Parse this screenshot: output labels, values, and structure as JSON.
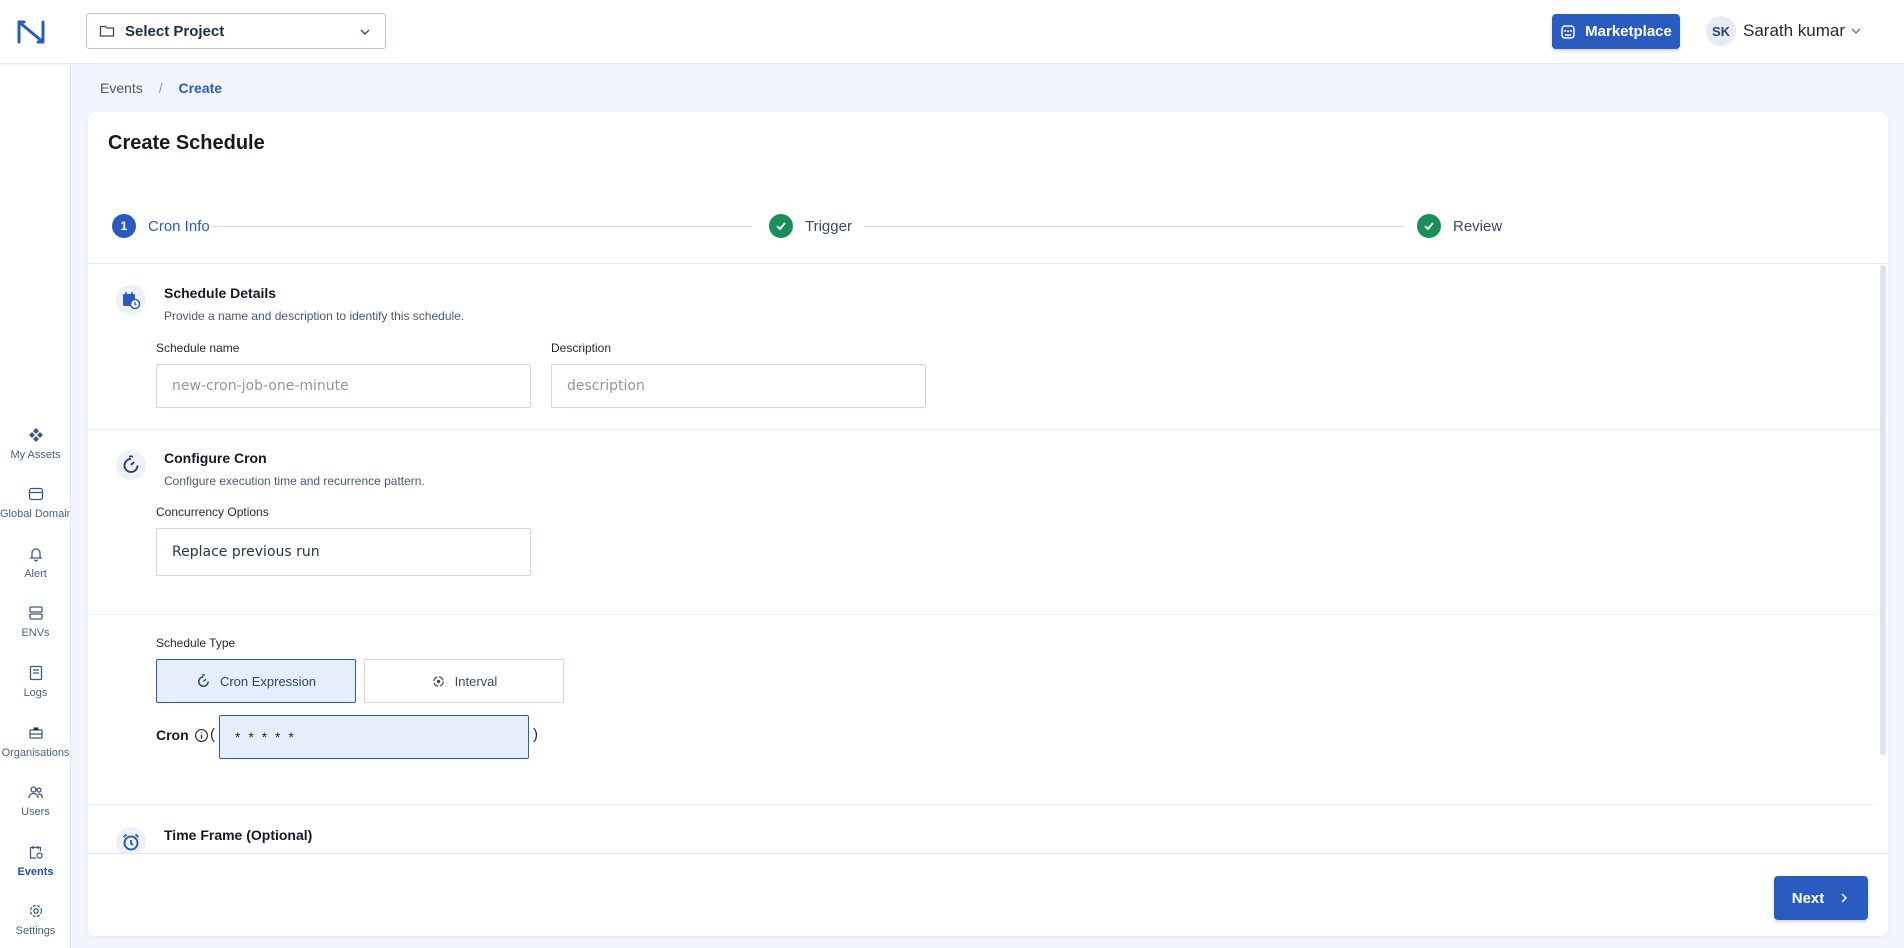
{
  "header": {
    "project_selector": "Select Project",
    "marketplace": "Marketplace",
    "user_initials": "SK",
    "user_name": "Sarath kumar"
  },
  "sidebar": {
    "items": [
      {
        "label": "My Assets",
        "icon": "diamond-icon"
      },
      {
        "label": "Global Domain",
        "icon": "store-icon"
      },
      {
        "label": "Alert",
        "icon": "bell-icon"
      },
      {
        "label": "ENVs",
        "icon": "server-icon"
      },
      {
        "label": "Logs",
        "icon": "book-icon"
      },
      {
        "label": "Organisations",
        "icon": "briefcase-icon"
      },
      {
        "label": "Users",
        "icon": "users-icon"
      },
      {
        "label": "Events",
        "icon": "calendar-gear-icon",
        "active": true
      },
      {
        "label": "Settings",
        "icon": "gear-icon"
      }
    ]
  },
  "breadcrumb": {
    "parent": "Events",
    "separator": "/",
    "current": "Create"
  },
  "page": {
    "title": "Create Schedule"
  },
  "stepper": {
    "steps": [
      {
        "number": "1",
        "label": "Cron Info",
        "state": "active"
      },
      {
        "label": "Trigger",
        "state": "done"
      },
      {
        "label": "Review",
        "state": "done"
      }
    ]
  },
  "schedule_details": {
    "title": "Schedule Details",
    "desc": "Provide a name and description to identify this schedule.",
    "name_label": "Schedule name",
    "name_placeholder": "new-cron-job-one-minute",
    "desc_label": "Description",
    "desc_placeholder": "description"
  },
  "configure_cron": {
    "title": "Configure Cron",
    "desc": "Configure execution time and recurrence pattern.",
    "concurrency_label": "Concurrency Options",
    "concurrency_value": "Replace previous run",
    "schedule_type_label": "Schedule Type",
    "type_cron": "Cron Expression",
    "type_interval": "Interval",
    "selected_type": "Cron Expression",
    "cron_label": "Cron",
    "paren_open": "(",
    "paren_close": ")",
    "cron_value": "* * * * *"
  },
  "time_frame": {
    "title": "Time Frame (Optional)"
  },
  "footer": {
    "next": "Next"
  },
  "colors": {
    "primary": "#2a5cc0",
    "success": "#1a8f5a",
    "background": "#f2f5fb"
  }
}
